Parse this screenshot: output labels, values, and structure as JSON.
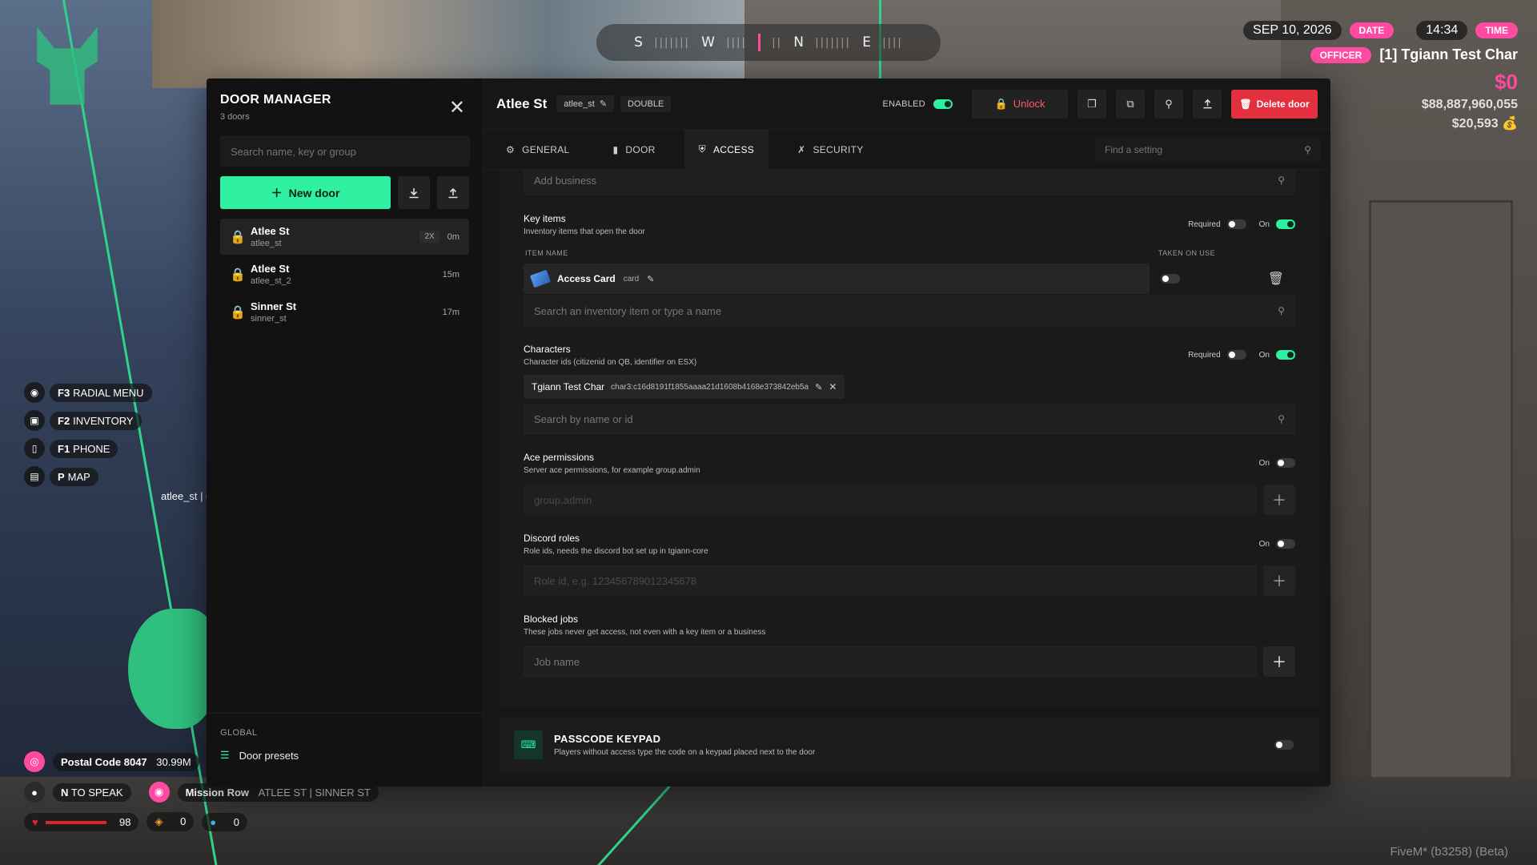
{
  "hud": {
    "date": "SEP 10, 2026",
    "date_tag": "DATE",
    "time": "14:34",
    "time_tag": "TIME",
    "job_tag": "OFFICER",
    "player": "[1] Tgiann Test Char",
    "cash": "$0",
    "bank": "$88,887,960,055",
    "dirty": "$20,593",
    "compass": [
      "S",
      "W",
      "N",
      "E"
    ],
    "keybinds": [
      {
        "key": "F3",
        "label": "RADIAL MENU"
      },
      {
        "key": "F2",
        "label": "INVENTORY"
      },
      {
        "key": "F1",
        "label": "PHONE"
      },
      {
        "key": "P",
        "label": "MAP"
      }
    ],
    "stray": "atlee_st | d",
    "postal": "Postal Code 8047",
    "postal_dist": "30.99M",
    "voice_key": "N",
    "voice_label": "TO SPEAK",
    "location_main": "Mission Row",
    "location_sub": "ATLEE ST | SINNER ST",
    "health": "98",
    "hunger": "0",
    "thirst": "0",
    "build": "FiveM* (b3258) (Beta)"
  },
  "sidebar": {
    "title": "DOOR MANAGER",
    "count": "3 doors",
    "search_placeholder": "Search name, key or group",
    "new_door": "New door",
    "doors": [
      {
        "name": "Atlee St",
        "key": "atlee_st",
        "badge": "2X",
        "time": "0m"
      },
      {
        "name": "Atlee St",
        "key": "atlee_st_2",
        "badge": "",
        "time": "15m"
      },
      {
        "name": "Sinner St",
        "key": "sinner_st",
        "badge": "",
        "time": "17m"
      }
    ],
    "global_label": "GLOBAL",
    "presets": "Door presets"
  },
  "door": {
    "title": "Atlee St",
    "key": "atlee_st",
    "type": "DOUBLE",
    "enabled_label": "ENABLED",
    "unlock": "Unlock",
    "delete": "Delete door"
  },
  "tabs": [
    "GENERAL",
    "DOOR",
    "ACCESS",
    "SECURITY"
  ],
  "find_placeholder": "Find a setting",
  "access": {
    "business_placeholder": "Add business",
    "key_items": {
      "title": "Key items",
      "sub": "Inventory items that open the door",
      "required": "Required",
      "on": "On",
      "col_item": "ITEM NAME",
      "col_taken": "TAKEN ON USE",
      "item_name": "Access Card",
      "item_key": "card",
      "search_placeholder": "Search an inventory item or type a name"
    },
    "characters": {
      "title": "Characters",
      "sub": "Character ids (citizenid on QB, identifier on ESX)",
      "required": "Required",
      "on": "On",
      "char_name": "Tgiann Test Char",
      "char_id": "char3:c16d8191f1855aaaa21d1608b4168e373842eb5a",
      "search_placeholder": "Search by name or id"
    },
    "ace": {
      "title": "Ace permissions",
      "sub": "Server ace permissions, for example group.admin",
      "on": "On",
      "placeholder": "group.admin"
    },
    "discord": {
      "title": "Discord roles",
      "sub": "Role ids, needs the discord bot set up in tgiann-core",
      "on": "On",
      "placeholder": "Role id, e.g. 123456789012345678"
    },
    "blocked": {
      "title": "Blocked jobs",
      "sub": "These jobs never get access, not even with a key item or a business",
      "placeholder": "Job name"
    }
  },
  "keypad": {
    "title": "PASSCODE KEYPAD",
    "sub": "Players without access type the code on a keypad placed next to the door"
  }
}
